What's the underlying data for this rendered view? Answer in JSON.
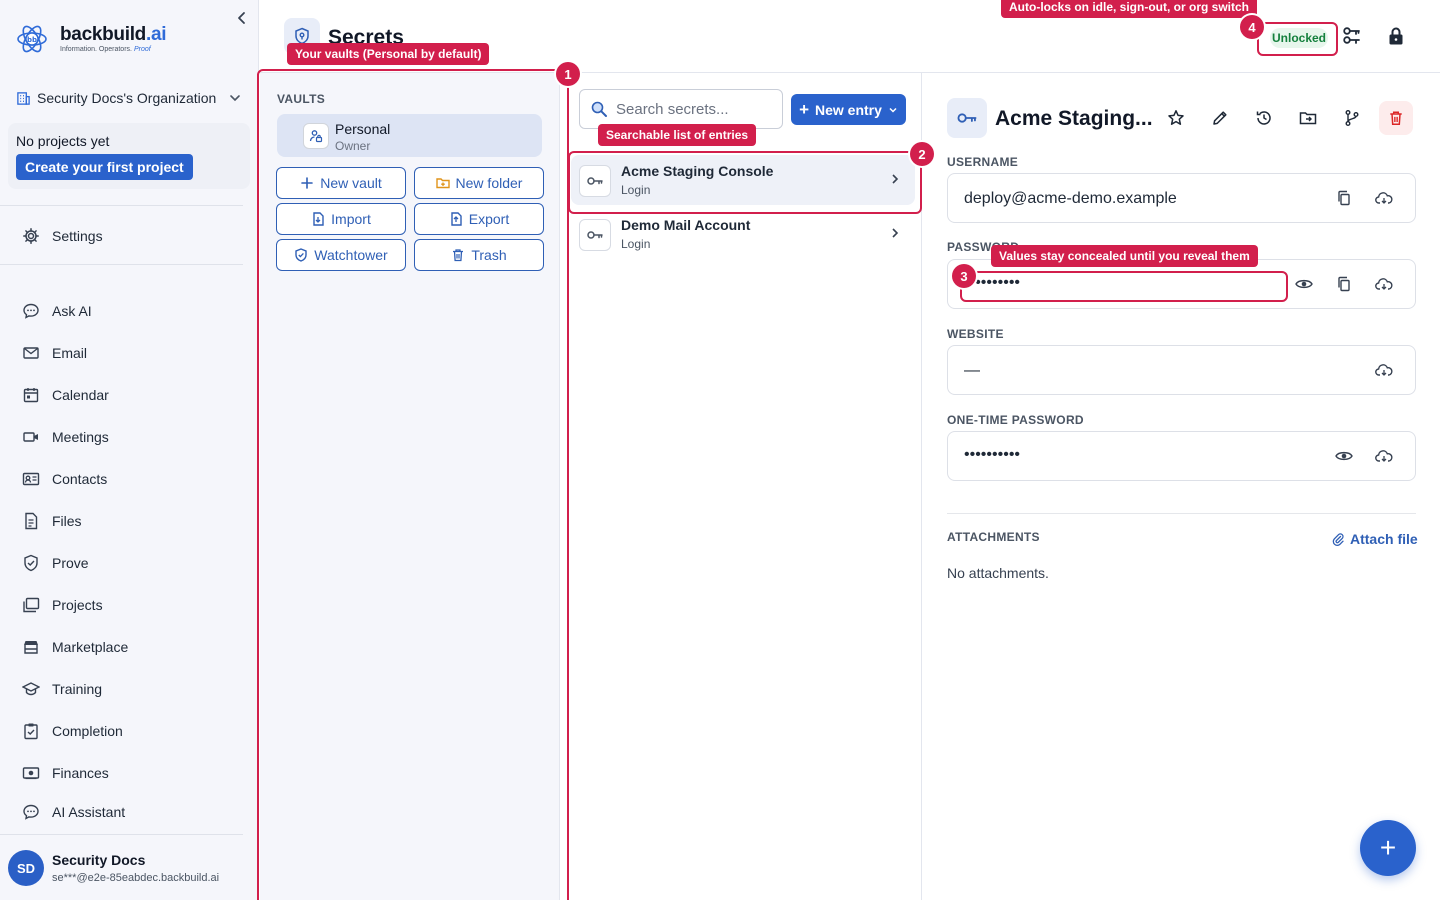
{
  "brand": {
    "name": "backbuild",
    "name_suffix": ".ai",
    "tagline": "Information. Operators.",
    "tagline_accent": "Proof",
    "accent_color": "#2f6bd8"
  },
  "sidebar": {
    "org_name": "Security Docs's Organization",
    "projects_empty": "No projects yet",
    "create_project": "Create your first project",
    "settings": "Settings",
    "items": [
      {
        "label": "Ask AI",
        "icon": "chat-icon"
      },
      {
        "label": "Email",
        "icon": "mail-icon"
      },
      {
        "label": "Calendar",
        "icon": "calendar-icon"
      },
      {
        "label": "Meetings",
        "icon": "video-icon"
      },
      {
        "label": "Contacts",
        "icon": "contact-card-icon"
      },
      {
        "label": "Files",
        "icon": "file-icon"
      },
      {
        "label": "Prove",
        "icon": "shield-check-icon"
      },
      {
        "label": "Projects",
        "icon": "folders-icon"
      },
      {
        "label": "Marketplace",
        "icon": "store-icon"
      },
      {
        "label": "Training",
        "icon": "graduation-cap-icon"
      },
      {
        "label": "Completion",
        "icon": "clipboard-check-icon"
      },
      {
        "label": "Finances",
        "icon": "cash-icon"
      },
      {
        "label": "AI Assistant",
        "icon": "chat-icon"
      }
    ],
    "user": {
      "initials": "SD",
      "name": "Security Docs",
      "email": "se***@e2e-85eabdec.backbuild.ai"
    }
  },
  "header": {
    "title": "Secrets",
    "status": "Unlocked",
    "status_color": "#15803d"
  },
  "vaults": {
    "label": "VAULTS",
    "selected": {
      "name": "Personal",
      "role": "Owner"
    },
    "buttons": {
      "new_vault": "New vault",
      "new_folder": "New folder",
      "import": "Import",
      "export": "Export",
      "watchtower": "Watchtower",
      "trash": "Trash"
    }
  },
  "entries": {
    "search_placeholder": "Search secrets...",
    "new_entry": "New entry",
    "list": [
      {
        "title": "Acme Staging Console",
        "type": "Login"
      },
      {
        "title": "Demo Mail Account",
        "type": "Login"
      }
    ]
  },
  "detail": {
    "title": "Acme Staging...",
    "fields": {
      "username_label": "USERNAME",
      "username": "deploy@acme-demo.example",
      "password_label": "PASSWORD",
      "password": "••••••••••",
      "website_label": "WEBSITE",
      "website": "—",
      "otp_label": "ONE-TIME PASSWORD",
      "otp": "••••••••••"
    },
    "attachments_label": "ATTACHMENTS",
    "attach_button": "Attach file",
    "attachments_empty": "No attachments."
  },
  "tour": {
    "color": "#d21f4c",
    "steps": [
      {
        "number": "1",
        "text": "Your vaults (Personal by default)"
      },
      {
        "number": "2",
        "text": "Searchable list of entries"
      },
      {
        "number": "3",
        "text": "Values stay concealed until you reveal them"
      },
      {
        "number": "4",
        "text": "Auto-locks on idle, sign-out, or org switch"
      }
    ]
  },
  "fab_label": "+"
}
